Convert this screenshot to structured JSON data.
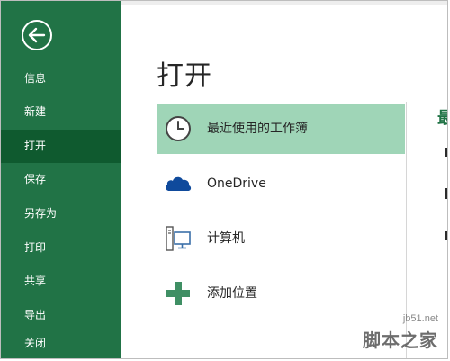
{
  "sidebar": {
    "items": [
      {
        "label": "信息"
      },
      {
        "label": "新建"
      },
      {
        "label": "打开",
        "active": true
      },
      {
        "label": "保存"
      },
      {
        "label": "另存为"
      },
      {
        "label": "打印"
      },
      {
        "label": "共享"
      },
      {
        "label": "导出"
      },
      {
        "label": "关闭"
      }
    ]
  },
  "main": {
    "title": "打开",
    "locations": [
      {
        "label": "最近使用的工作簿",
        "icon": "clock-icon",
        "selected": true
      },
      {
        "label": "OneDrive",
        "icon": "cloud-icon"
      },
      {
        "label": "计算机",
        "icon": "computer-icon"
      },
      {
        "label": "添加位置",
        "icon": "plus-icon"
      }
    ],
    "right_heading": "最"
  },
  "watermark": {
    "site": "jb51.net",
    "name": "脚本之家"
  },
  "colors": {
    "sidebar": "#217346",
    "sidebar_active": "#0f5a2f",
    "selected": "#9fd5b7",
    "onedrive_blue": "#0f4a9c",
    "plus_green": "#3f8f64"
  }
}
